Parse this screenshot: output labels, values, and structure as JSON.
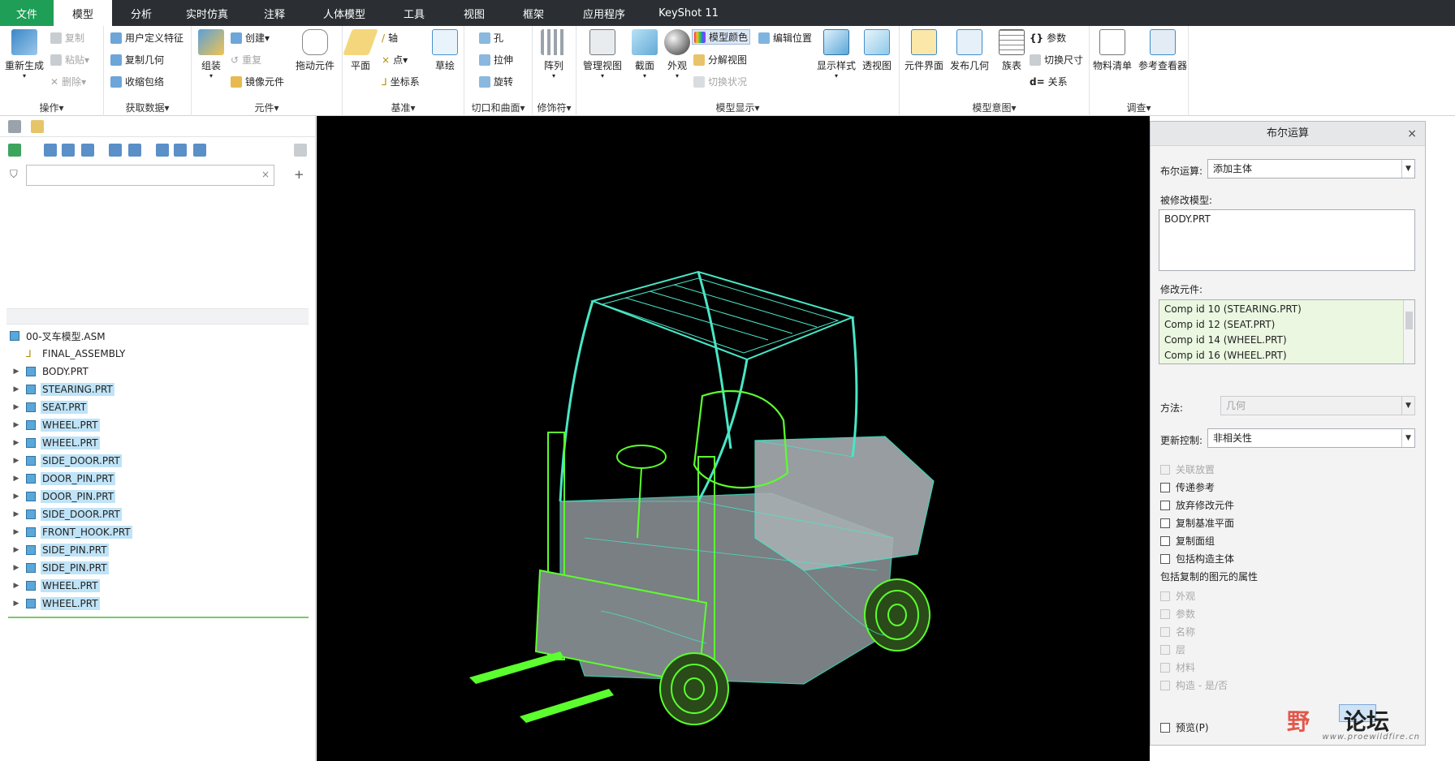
{
  "tabs": [
    {
      "label": "文件",
      "kind": "file",
      "w": 66
    },
    {
      "label": "模型",
      "kind": "active",
      "w": 72
    },
    {
      "label": "分析",
      "w": 72
    },
    {
      "label": "实时仿真",
      "w": 90
    },
    {
      "label": "注释",
      "w": 76
    },
    {
      "label": "人体模型",
      "w": 96
    },
    {
      "label": "工具",
      "w": 76
    },
    {
      "label": "视图",
      "w": 72
    },
    {
      "label": "框架",
      "w": 74
    },
    {
      "label": "应用程序",
      "w": 100
    },
    {
      "label": "KeyShot 11",
      "w": 108
    }
  ],
  "ribbon": {
    "operations": {
      "label": "操作▾",
      "regen": "重新生成",
      "copy": "复制",
      "paste": "粘贴",
      "delete": "删除"
    },
    "get_data": {
      "label": "获取数据▾",
      "udf": "用户定义特征",
      "copy_geom": "复制几何",
      "shrinkwrap": "收缩包络"
    },
    "component": {
      "label": "元件▾",
      "assemble": "组装",
      "create": "创建",
      "repeat": "重复",
      "mirror": "镜像元件",
      "drag": "拖动元件"
    },
    "datum": {
      "label": "基准▾",
      "plane": "平面",
      "axis": "轴",
      "point": "点",
      "csys": "坐标系",
      "sketch": "草绘"
    },
    "cut_surface": {
      "label": "切口和曲面▾",
      "hole": "孔",
      "extrude": "拉伸",
      "revolve": "旋转"
    },
    "modifiers": {
      "label": "修饰符▾",
      "pattern": "阵列"
    },
    "model_display": {
      "label": "模型显示▾",
      "manage_views": "管理视图",
      "section": "截面",
      "appearance": "外观",
      "model_color": "模型颜色",
      "edit_position": "编辑位置",
      "exploded_view": "分解视图",
      "toggle_status": "切换状况",
      "display_style": "显示样式",
      "perspective": "透视图"
    },
    "model_intent": {
      "label": "模型意图▾",
      "component_interface": "元件界面",
      "publish_geom": "发布几何",
      "family_table": "族表",
      "parameters": "参数",
      "toggle_dims": "切换尺寸",
      "relations": "关系"
    },
    "investigate": {
      "label": "调查▾",
      "bom": "物料清单",
      "ref_viewer": "参考查看器"
    }
  },
  "tree": {
    "root": "00-叉车模型.ASM",
    "items": [
      {
        "label": "FINAL_ASSEMBLY",
        "type": "datum",
        "selected": false
      },
      {
        "label": "BODY.PRT",
        "selected": false
      },
      {
        "label": "STEARING.PRT",
        "selected": true
      },
      {
        "label": "SEAT.PRT",
        "selected": true
      },
      {
        "label": "WHEEL.PRT",
        "selected": true
      },
      {
        "label": "WHEEL.PRT",
        "selected": true
      },
      {
        "label": "SIDE_DOOR.PRT",
        "selected": true
      },
      {
        "label": "DOOR_PIN.PRT",
        "selected": true
      },
      {
        "label": "DOOR_PIN.PRT",
        "selected": true
      },
      {
        "label": "SIDE_DOOR.PRT",
        "selected": true
      },
      {
        "label": "FRONT_HOOK.PRT",
        "selected": true
      },
      {
        "label": "SIDE_PIN.PRT",
        "selected": true
      },
      {
        "label": "SIDE_PIN.PRT",
        "selected": true
      },
      {
        "label": "WHEEL.PRT",
        "selected": true
      },
      {
        "label": "WHEEL.PRT",
        "selected": true
      }
    ]
  },
  "dialog": {
    "title": "布尔运算",
    "op_label": "布尔运算:",
    "op_value": "添加主体",
    "modified_model_label": "被修改模型:",
    "modified_model_value": "BODY.PRT",
    "modifying_comps_label": "修改元件:",
    "modifying_comps": [
      "Comp id 10 (STEARING.PRT)",
      "Comp id 12 (SEAT.PRT)",
      "Comp id 14 (WHEEL.PRT)",
      "Comp id 16 (WHEEL.PRT)"
    ],
    "method_label": "方法:",
    "method_value": "几何",
    "update_label": "更新控制:",
    "update_value": "非相关性",
    "options": [
      {
        "label": "关联放置",
        "disabled": true
      },
      {
        "label": "传递参考",
        "disabled": false
      },
      {
        "label": "放弃修改元件",
        "disabled": false
      },
      {
        "label": "复制基准平面",
        "disabled": false
      },
      {
        "label": "复制面组",
        "disabled": false
      },
      {
        "label": "包括构造主体",
        "disabled": false
      }
    ],
    "attrs_header": "包括复制的图元的属性",
    "attrs": [
      {
        "label": "外观"
      },
      {
        "label": "参数"
      },
      {
        "label": "名称"
      },
      {
        "label": "层"
      },
      {
        "label": "材料"
      },
      {
        "label": "构造 - 是/否"
      }
    ],
    "preview_label": "预览(P)"
  },
  "watermark": {
    "left": "野",
    "right": "论坛",
    "url": "www.proewildfire.cn"
  },
  "colors": {
    "wire": "#49e6c6",
    "highlight": "#5cff2e",
    "body": "#9aa1a6"
  }
}
